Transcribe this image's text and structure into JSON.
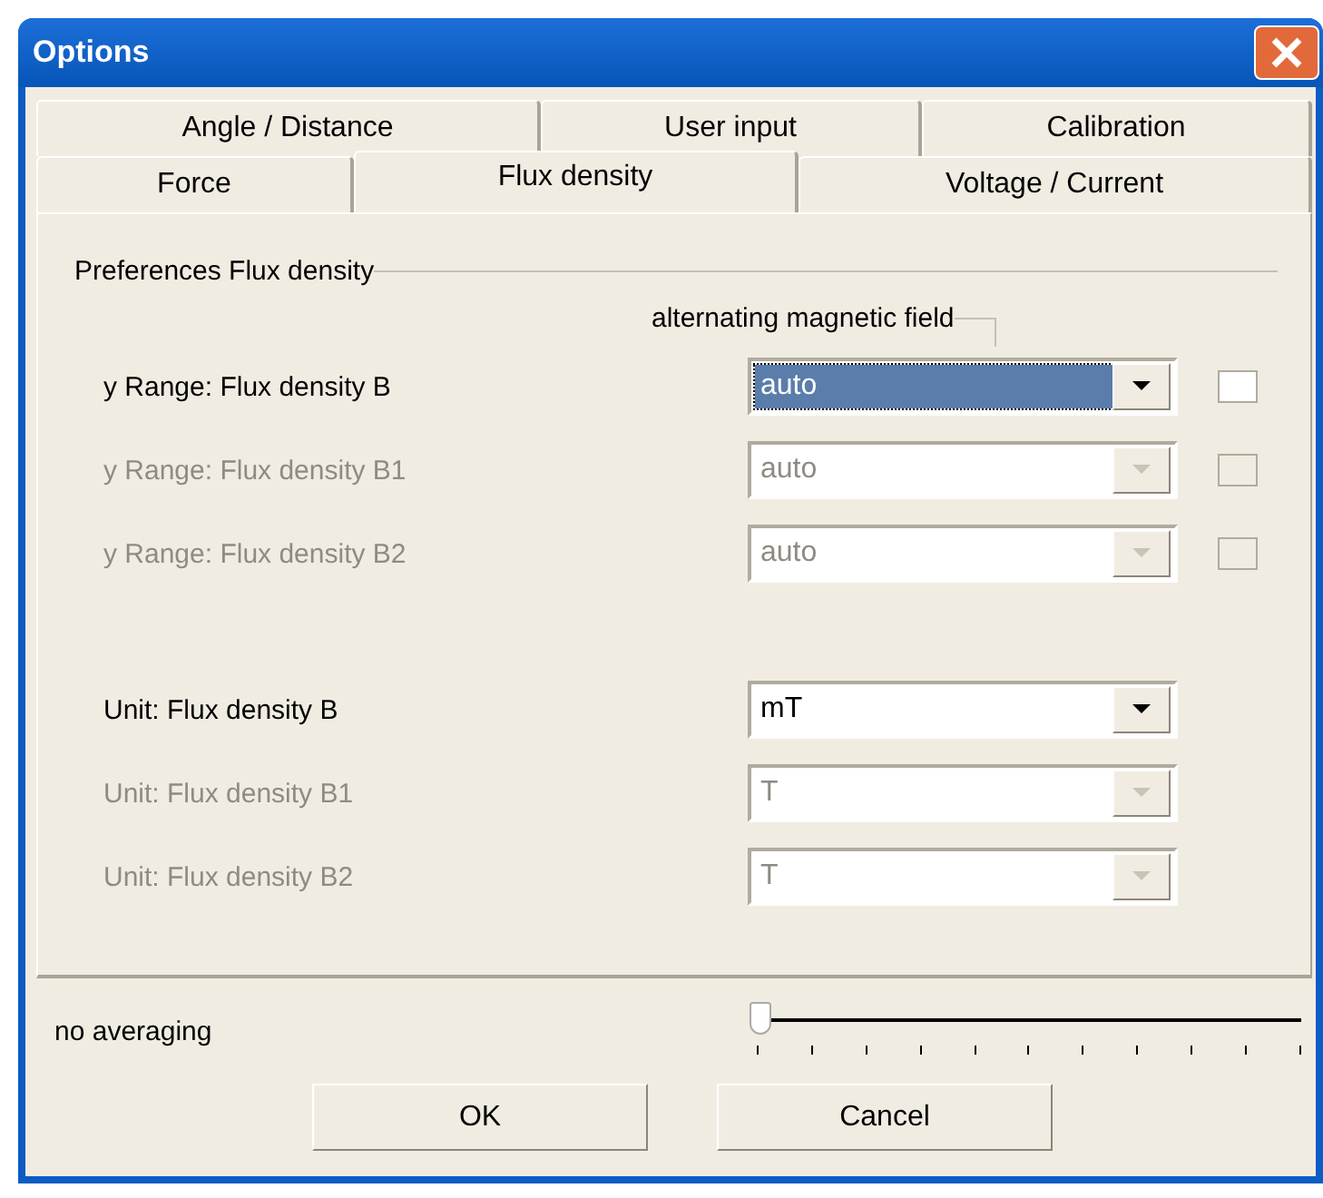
{
  "window": {
    "title": "Options"
  },
  "tab_rows": [
    {
      "tabs": [
        {
          "label": "Angle / Distance",
          "selected": false
        },
        {
          "label": "User input",
          "selected": false
        },
        {
          "label": "Calibration",
          "selected": false
        }
      ]
    },
    {
      "tabs": [
        {
          "label": "Force",
          "selected": false
        },
        {
          "label": "Flux density",
          "selected": true
        },
        {
          "label": "Voltage / Current",
          "selected": false
        }
      ]
    }
  ],
  "group": {
    "title": "Preferences Flux density",
    "column_header": "alternating magnetic field"
  },
  "range_rows": [
    {
      "label": "y Range: Flux density B",
      "value": "auto",
      "disabled": false,
      "focused": true,
      "checked": false
    },
    {
      "label": "y Range: Flux density B1",
      "value": "auto",
      "disabled": true,
      "focused": false,
      "checked": false
    },
    {
      "label": "y Range: Flux density B2",
      "value": "auto",
      "disabled": true,
      "focused": false,
      "checked": false
    }
  ],
  "unit_rows": [
    {
      "label": "Unit: Flux density B",
      "value": "mT",
      "disabled": false
    },
    {
      "label": "Unit: Flux density B1",
      "value": "T",
      "disabled": true
    },
    {
      "label": "Unit: Flux density B2",
      "value": "T",
      "disabled": true
    }
  ],
  "averaging": {
    "label": "no averaging",
    "level": 0
  },
  "buttons": [
    "OK",
    "Cancel"
  ]
}
